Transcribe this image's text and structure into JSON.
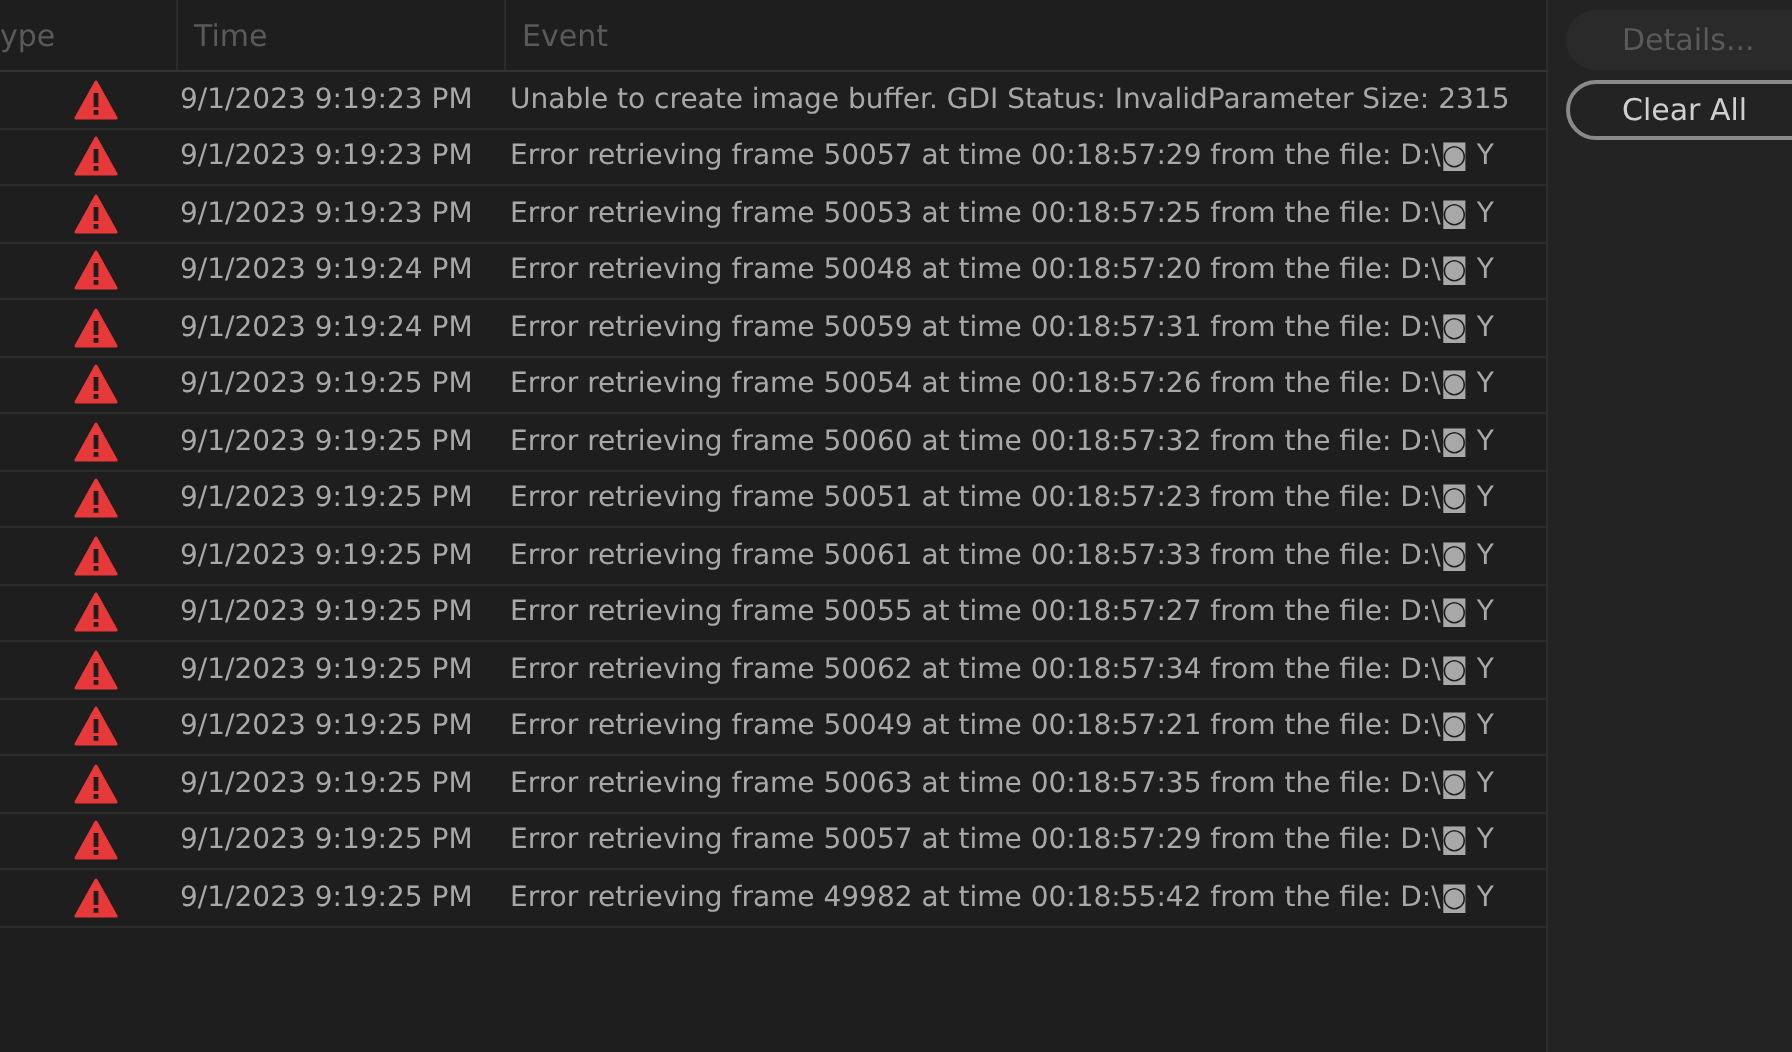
{
  "table": {
    "columns": [
      "ype",
      "Time",
      "Event"
    ],
    "rows": [
      {
        "kind": "error",
        "time": "9/1/2023 9:19:23 PM",
        "event": "Unable to create image buffer. GDI Status: InvalidParameter Size: 2315"
      },
      {
        "kind": "error",
        "time": "9/1/2023 9:19:23 PM",
        "event": "Error retrieving frame 50057 at time 00:18:57:29 from the file: D:\\◙ Y"
      },
      {
        "kind": "error",
        "time": "9/1/2023 9:19:23 PM",
        "event": "Error retrieving frame 50053 at time 00:18:57:25 from the file: D:\\◙ Y"
      },
      {
        "kind": "error",
        "time": "9/1/2023 9:19:24 PM",
        "event": "Error retrieving frame 50048 at time 00:18:57:20 from the file: D:\\◙ Y"
      },
      {
        "kind": "error",
        "time": "9/1/2023 9:19:24 PM",
        "event": "Error retrieving frame 50059 at time 00:18:57:31 from the file: D:\\◙ Y"
      },
      {
        "kind": "error",
        "time": "9/1/2023 9:19:25 PM",
        "event": "Error retrieving frame 50054 at time 00:18:57:26 from the file: D:\\◙ Y"
      },
      {
        "kind": "error",
        "time": "9/1/2023 9:19:25 PM",
        "event": "Error retrieving frame 50060 at time 00:18:57:32 from the file: D:\\◙ Y"
      },
      {
        "kind": "error",
        "time": "9/1/2023 9:19:25 PM",
        "event": "Error retrieving frame 50051 at time 00:18:57:23 from the file: D:\\◙ Y"
      },
      {
        "kind": "error",
        "time": "9/1/2023 9:19:25 PM",
        "event": "Error retrieving frame 50061 at time 00:18:57:33 from the file: D:\\◙ Y"
      },
      {
        "kind": "error",
        "time": "9/1/2023 9:19:25 PM",
        "event": "Error retrieving frame 50055 at time 00:18:57:27 from the file: D:\\◙ Y"
      },
      {
        "kind": "error",
        "time": "9/1/2023 9:19:25 PM",
        "event": "Error retrieving frame 50062 at time 00:18:57:34 from the file: D:\\◙ Y"
      },
      {
        "kind": "error",
        "time": "9/1/2023 9:19:25 PM",
        "event": "Error retrieving frame 50049 at time 00:18:57:21 from the file: D:\\◙ Y"
      },
      {
        "kind": "error",
        "time": "9/1/2023 9:19:25 PM",
        "event": "Error retrieving frame 50063 at time 00:18:57:35 from the file: D:\\◙ Y"
      },
      {
        "kind": "error",
        "time": "9/1/2023 9:19:25 PM",
        "event": "Error retrieving frame 50057 at time 00:18:57:29 from the file: D:\\◙ Y"
      },
      {
        "kind": "error",
        "time": "9/1/2023 9:19:25 PM",
        "event": "Error retrieving frame 49982 at time 00:18:55:42 from the file: D:\\◙ Y"
      }
    ]
  },
  "buttons": [
    {
      "label": "Details...",
      "disabled": true
    },
    {
      "label": "Clear All",
      "disabled": false
    }
  ]
}
